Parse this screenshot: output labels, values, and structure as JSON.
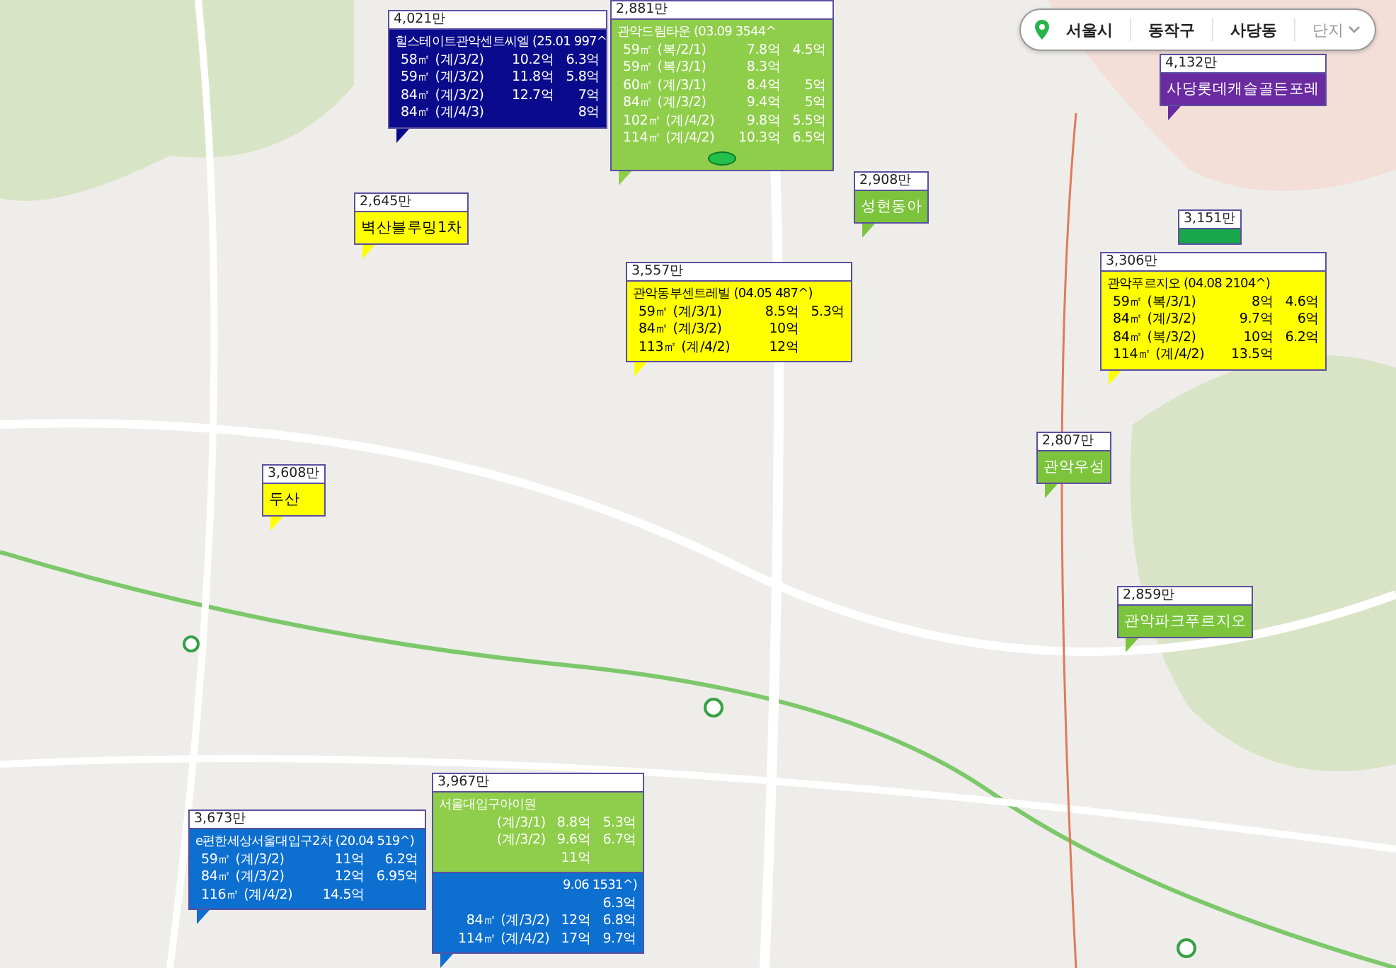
{
  "location_bar": {
    "items": [
      "서울시",
      "동작구",
      "사당동"
    ],
    "dropdown": "단지"
  },
  "cards": [
    {
      "price": "4,021만",
      "color": "#0a0a8c",
      "title": "힐스테이트관악센트씨엘 (25.01 997^",
      "rows": [
        {
          "area": "58㎡ (계/3/2)",
          "sale": "10.2억",
          "lease": "6.3억"
        },
        {
          "area": "59㎡ (계/3/2)",
          "sale": "11.8억",
          "lease": "5.8억"
        },
        {
          "area": "84㎡ (계/3/2)",
          "sale": "12.7억",
          "lease": "7억"
        },
        {
          "area": "84㎡ (계/4/3)",
          "lease": "8억"
        }
      ]
    },
    {
      "price": "2,881만",
      "color": "#8fce4a",
      "title": "관악드림타운 (03.09 3544^",
      "rows": [
        {
          "area": "59㎡ (복/2/1)",
          "sale": "7.8억",
          "lease": "4.5억"
        },
        {
          "area": "59㎡ (복/3/1)",
          "sale": "8.3억"
        },
        {
          "area": "60㎡ (계/3/1)",
          "sale": "8.4억",
          "lease": "5억"
        },
        {
          "area": "84㎡ (계/3/2)",
          "sale": "9.4억",
          "lease": "5억"
        },
        {
          "area": "102㎡ (계/4/2)",
          "sale": "9.8억",
          "lease": "5.5억"
        },
        {
          "area": "114㎡ (계/4/2)",
          "sale": "10.3억",
          "lease": "6.5억"
        }
      ],
      "marker": true
    },
    {
      "price": "4,132만",
      "color": "#6a2aa0",
      "name": "사당롯데캐슬골든포레"
    },
    {
      "price": "2,645만",
      "color": "#ffff00",
      "name": "벽산블루밍1차"
    },
    {
      "price": "2,908만",
      "color": "#7cc43c",
      "name": "성현동아"
    },
    {
      "price": "3,557만",
      "color": "#ffff00",
      "title": "관악동부센트레빌 (04.05 487^)",
      "rows": [
        {
          "area": "59㎡ (계/3/1)",
          "sale": "8.5억",
          "lease": "5.3억"
        },
        {
          "area": "84㎡ (계/3/2)",
          "sale": "10억"
        },
        {
          "area": "113㎡ (계/4/2)",
          "sale": "12억"
        }
      ]
    },
    {
      "price": "3,151만",
      "color": "#1aa64a"
    },
    {
      "price": "3,306만",
      "color": "#ffff00",
      "title": "관악푸르지오 (04.08 2104^)",
      "rows": [
        {
          "area": "59㎡ (복/3/1)",
          "sale": "8억",
          "lease": "4.6억"
        },
        {
          "area": "84㎡ (계/3/2)",
          "sale": "9.7억",
          "lease": "6억"
        },
        {
          "area": "84㎡ (복/3/2)",
          "sale": "10억",
          "lease": "6.2억"
        },
        {
          "area": "114㎡ (계/4/2)",
          "sale": "13.5억"
        }
      ]
    },
    {
      "price": "2,807만",
      "color": "#7cc43c",
      "name": "관악우성"
    },
    {
      "price": "2,859만",
      "color": "#7cc43c",
      "name": "관악파크푸르지오"
    },
    {
      "price": "3,608만",
      "color": "#ffff00",
      "name": "두산"
    },
    {
      "price": "3,967만",
      "color": "#8fce4a",
      "title": "서울대입구아이원",
      "rows": [
        {
          "area": "(계/3/1)",
          "sale": "8.8억",
          "lease": "5.3억"
        },
        {
          "area": "(계/3/2)",
          "sale": "9.6억",
          "lease": "6.7억"
        },
        {
          "sale": "11억"
        }
      ]
    },
    {
      "color": "#0d6fd0",
      "title": "9.06 1531^)",
      "rows": [
        {
          "lease": "6.3억"
        },
        {
          "area": "84㎡ (계/3/2)",
          "sale": "12억",
          "lease": "6.8억"
        },
        {
          "area": "114㎡ (계/4/2)",
          "sale": "17억",
          "lease": "9.7억"
        }
      ]
    },
    {
      "price": "3,673만",
      "color": "#0d6fd0",
      "title": "e편한세상서울대입구2차 (20.04 519^)",
      "rows": [
        {
          "area": "59㎡ (계/3/2)",
          "sale": "11억",
          "lease": "6.2억"
        },
        {
          "area": "84㎡ (계/3/2)",
          "sale": "12억",
          "lease": "6.95억"
        },
        {
          "area": "116㎡ (계/4/2)",
          "sale": "14.5억"
        }
      ]
    }
  ]
}
